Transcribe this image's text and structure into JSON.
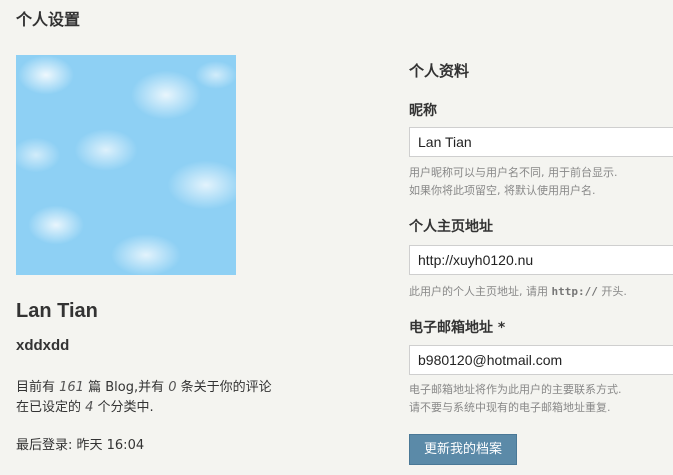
{
  "page": {
    "title": "个人设置"
  },
  "profile": {
    "display_name": "Lan Tian",
    "username": "xddxdd",
    "stats": {
      "prefix": "目前有 ",
      "post_count": "161",
      "mid1": " 篇 Blog,并有 ",
      "comment_count": "0",
      "mid2": " 条关于你的评论",
      "line2_prefix": "在已设定的 ",
      "category_count": "4",
      "line2_suffix": " 个分类中."
    },
    "last_login": "最后登录: 昨天 16:04"
  },
  "form": {
    "section_title": "个人资料",
    "nickname": {
      "label": "昵称",
      "value": "Lan Tian",
      "hint_line1": "用户昵称可以与用户名不同, 用于前台显示.",
      "hint_line2": "如果你将此项留空, 将默认使用用户名."
    },
    "homepage": {
      "label": "个人主页地址",
      "value": "http://xuyh0120.nu",
      "hint_prefix": "此用户的个人主页地址, 请用 ",
      "hint_code": "http://",
      "hint_suffix": " 开头."
    },
    "email": {
      "label": "电子邮箱地址 *",
      "value": "b980120@hotmail.com",
      "hint_line1": "电子邮箱地址将作为此用户的主要联系方式.",
      "hint_line2": "请不要与系统中现有的电子邮箱地址重复."
    },
    "submit_label": "更新我的档案"
  },
  "colors": {
    "background": "#f4f4f0",
    "button": "#5b8aa8",
    "hint_text": "#888888"
  }
}
